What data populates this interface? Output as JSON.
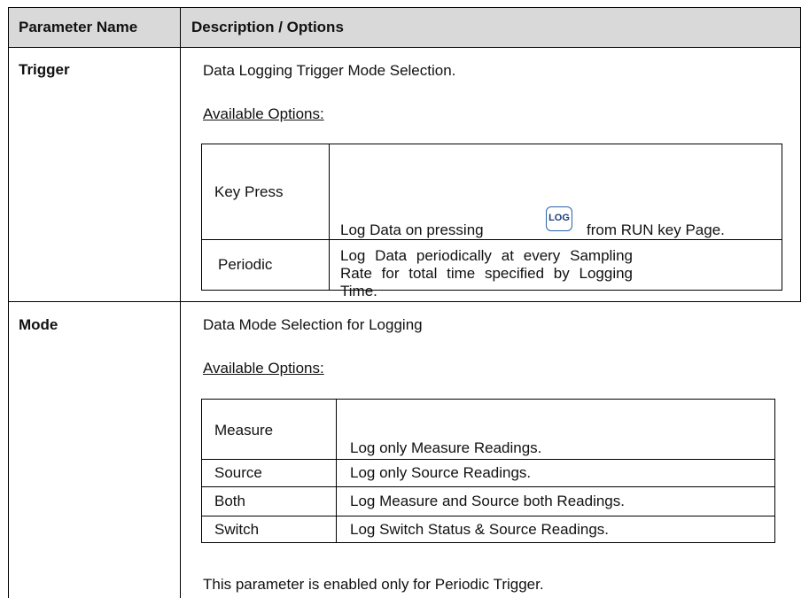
{
  "table": {
    "headers": [
      "Parameter Name",
      "Description / Options"
    ],
    "rows": [
      {
        "name": "Trigger",
        "description": "Data Logging Trigger Mode Selection.",
        "options_label": "Available Options:",
        "options": [
          {
            "name": "Key Press",
            "desc_before": "Log Data on pressing",
            "key_icon": "LOG",
            "desc_after": "from RUN key Page."
          },
          {
            "name": "Periodic",
            "desc": "Log Data periodically at every Sampling Rate for total time specified by Logging Time."
          }
        ]
      },
      {
        "name": "Mode",
        "description": "Data Mode Selection for Logging",
        "options_label": "Available Options:",
        "options": [
          {
            "name": "Measure",
            "desc": "Log only Measure Readings."
          },
          {
            "name": "Source",
            "desc": "Log only Source Readings."
          },
          {
            "name": "Both",
            "desc": "Log Measure and Source both Readings."
          },
          {
            "name": "Switch",
            "desc": "Log Switch Status & Source Readings."
          }
        ],
        "note": "This parameter is enabled only for Periodic Trigger."
      }
    ]
  },
  "colors": {
    "header_bg": "#d9d9d9",
    "key_border": "#2b62a8"
  },
  "icons": {
    "log_key": "log-key-icon"
  }
}
